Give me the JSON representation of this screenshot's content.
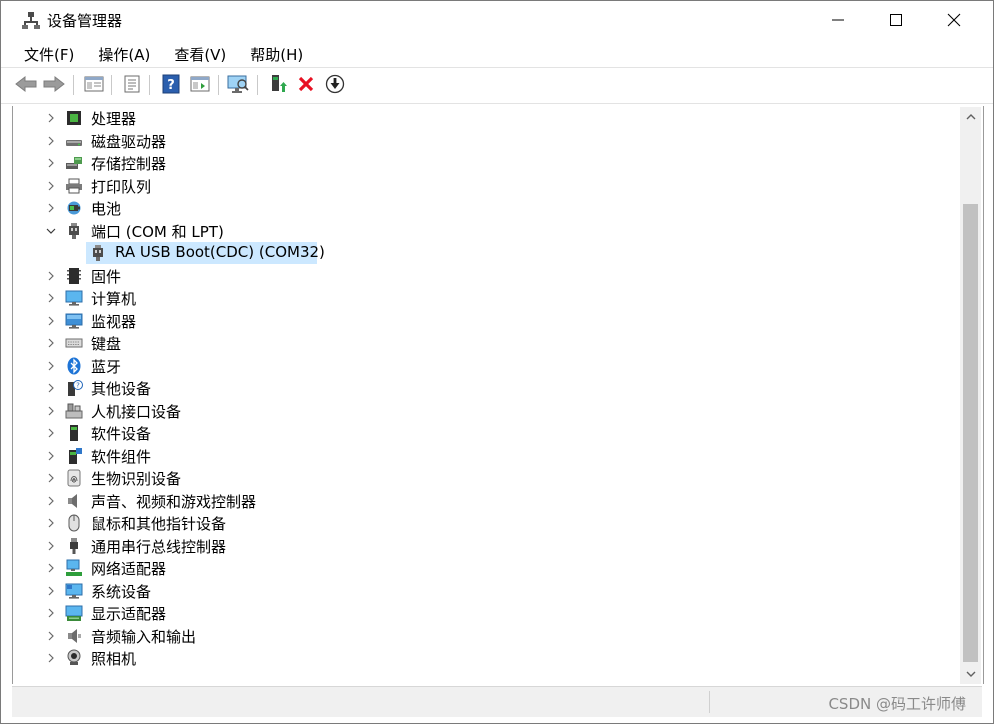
{
  "window": {
    "title": "设备管理器"
  },
  "menu": [
    "文件(F)",
    "操作(A)",
    "查看(V)",
    "帮助(H)"
  ],
  "toolbar": [
    {
      "icon": "back-arrow-icon"
    },
    {
      "icon": "forward-arrow-icon"
    },
    {
      "icon": "show-hide-console-tree-icon"
    },
    {
      "icon": "properties-icon"
    },
    {
      "icon": "help-icon"
    },
    {
      "icon": "action-pane-icon"
    },
    {
      "icon": "scan-hardware-changes-icon"
    },
    {
      "icon": "update-driver-icon"
    },
    {
      "icon": "uninstall-device-icon"
    },
    {
      "icon": "disable-device-icon"
    }
  ],
  "tree": {
    "nodes": [
      {
        "label": "处理器",
        "icon": "processor-icon",
        "expanded": false
      },
      {
        "label": "磁盘驱动器",
        "icon": "disk-drive-icon",
        "expanded": false
      },
      {
        "label": "存储控制器",
        "icon": "storage-controller-icon",
        "expanded": false
      },
      {
        "label": "打印队列",
        "icon": "printer-icon",
        "expanded": false
      },
      {
        "label": "电池",
        "icon": "battery-icon",
        "expanded": false
      },
      {
        "label": "端口 (COM 和 LPT)",
        "icon": "port-icon",
        "expanded": true,
        "children": [
          {
            "label": "RA USB Boot(CDC) (COM32)",
            "icon": "port-icon",
            "selected": true
          }
        ]
      },
      {
        "label": "固件",
        "icon": "firmware-icon",
        "expanded": false
      },
      {
        "label": "计算机",
        "icon": "computer-icon",
        "expanded": false
      },
      {
        "label": "监视器",
        "icon": "monitor-icon",
        "expanded": false
      },
      {
        "label": "键盘",
        "icon": "keyboard-icon",
        "expanded": false
      },
      {
        "label": "蓝牙",
        "icon": "bluetooth-icon",
        "expanded": false
      },
      {
        "label": "其他设备",
        "icon": "other-devices-icon",
        "expanded": false
      },
      {
        "label": "人机接口设备",
        "icon": "hid-icon",
        "expanded": false
      },
      {
        "label": "软件设备",
        "icon": "software-device-icon",
        "expanded": false
      },
      {
        "label": "软件组件",
        "icon": "software-component-icon",
        "expanded": false
      },
      {
        "label": "生物识别设备",
        "icon": "biometric-icon",
        "expanded": false
      },
      {
        "label": "声音、视频和游戏控制器",
        "icon": "sound-icon",
        "expanded": false
      },
      {
        "label": "鼠标和其他指针设备",
        "icon": "mouse-icon",
        "expanded": false
      },
      {
        "label": "通用串行总线控制器",
        "icon": "usb-icon",
        "expanded": false
      },
      {
        "label": "网络适配器",
        "icon": "network-adapter-icon",
        "expanded": false
      },
      {
        "label": "系统设备",
        "icon": "system-device-icon",
        "expanded": false
      },
      {
        "label": "显示适配器",
        "icon": "display-adapter-icon",
        "expanded": false
      },
      {
        "label": "音频输入和输出",
        "icon": "audio-io-icon",
        "expanded": false
      },
      {
        "label": "照相机",
        "icon": "camera-icon",
        "expanded": false
      }
    ]
  },
  "statusbar": {
    "watermark": "CSDN @码工许师傅"
  },
  "colors": {
    "selection": "#cce8ff",
    "accent": "#1e63b8",
    "uninstall": "#e81123"
  }
}
